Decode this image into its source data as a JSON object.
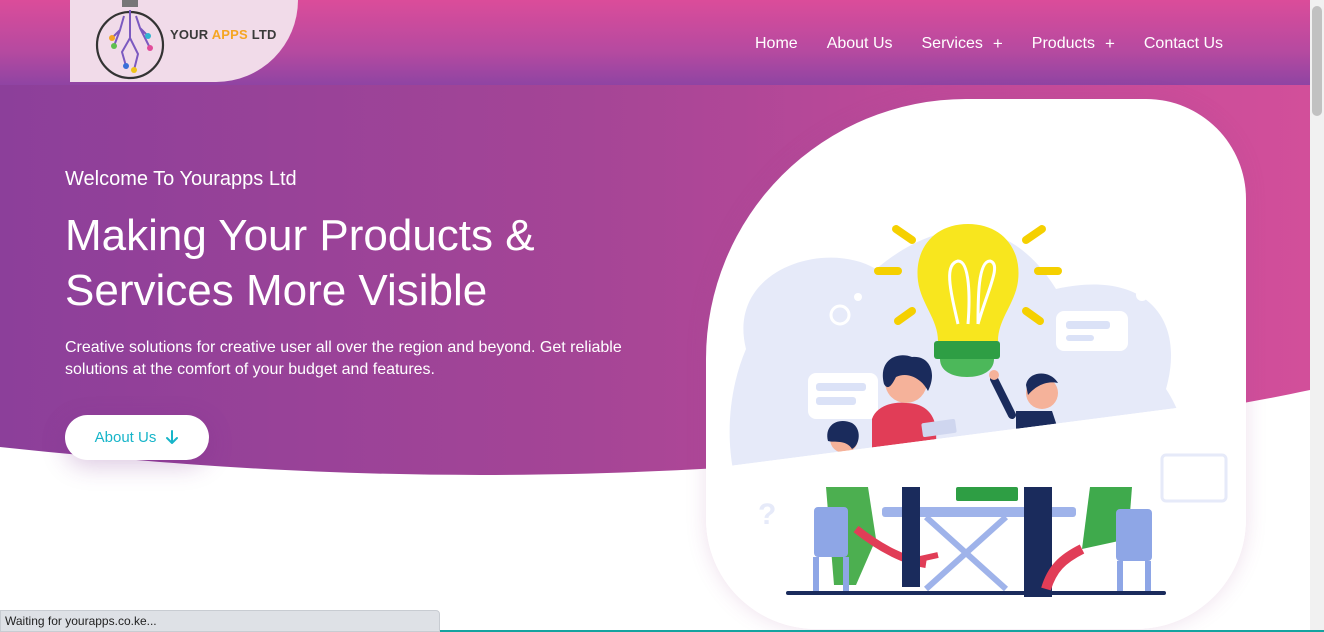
{
  "logo": {
    "part1": "YOUR ",
    "accent": "APPS",
    "part2": " LTD"
  },
  "nav": [
    {
      "label": "Home"
    },
    {
      "label": "About Us"
    },
    {
      "label": "Services",
      "plus": "+"
    },
    {
      "label": "Products",
      "plus": "+"
    },
    {
      "label": "Contact Us"
    }
  ],
  "hero": {
    "welcome": "Welcome To Yourapps Ltd",
    "headline_line1": "Making Your Products &",
    "headline_line2": "Services More Visible",
    "description": "Creative solutions for creative user all over the region and beyond. Get reliable solutions at the comfort of your budget and features.",
    "cta_label": "About Us"
  },
  "status_bar": {
    "text": "Waiting for yourapps.co.ke..."
  },
  "colors": {
    "accent_cyan": "#17b5c9",
    "logo_accent": "#f5a623",
    "status_line": "#14a3a0"
  }
}
